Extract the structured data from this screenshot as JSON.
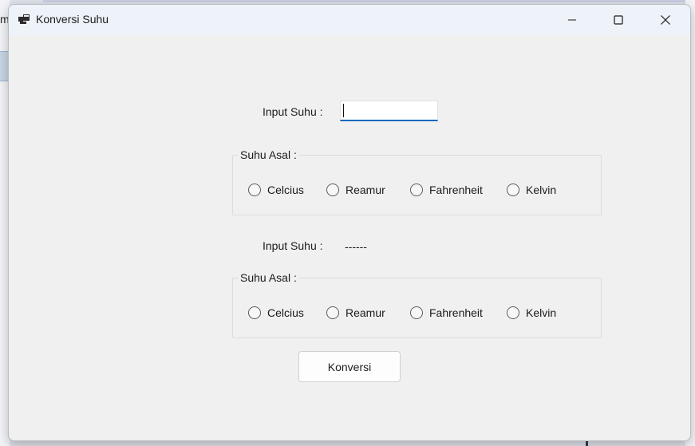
{
  "window": {
    "title": "Konversi Suhu"
  },
  "background": {
    "partial_letter": "m"
  },
  "form": {
    "input_label": "Input Suhu :",
    "input_value": "",
    "source_group": {
      "legend": "Suhu Asal :",
      "options": [
        "Celcius",
        "Reamur",
        "Fahrenheit",
        "Kelvin"
      ]
    },
    "output_label": "Input Suhu :",
    "output_value": "------",
    "target_group": {
      "legend": "Suhu Asal :",
      "options": [
        "Celcius",
        "Reamur",
        "Fahrenheit",
        "Kelvin"
      ]
    },
    "convert_button": "Konversi"
  },
  "colors": {
    "accent": "#0067c0",
    "window_bg": "#f0f0f0",
    "titlebar_bg": "#eef2f9"
  }
}
